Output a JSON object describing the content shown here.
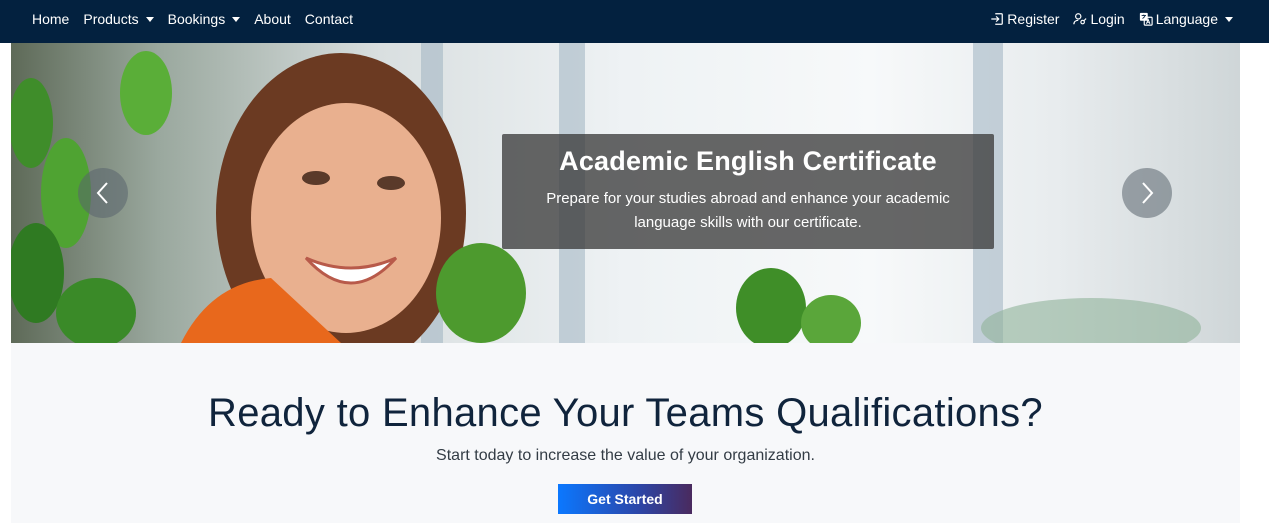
{
  "nav": {
    "left": [
      {
        "label": "Home",
        "dropdown": false
      },
      {
        "label": "Products",
        "dropdown": true
      },
      {
        "label": "Bookings",
        "dropdown": true
      },
      {
        "label": "About",
        "dropdown": false
      },
      {
        "label": "Contact",
        "dropdown": false
      }
    ],
    "register_label": "Register",
    "login_label": "Login",
    "language_label": "Language"
  },
  "hero": {
    "title": "Academic English Certificate",
    "text": "Prepare for your studies abroad and enhance your academic language skills with our certificate."
  },
  "cta": {
    "heading": "Ready to Enhance Your Teams Qualifications?",
    "subtext": "Start today to increase the value of your organization.",
    "button_label": "Get Started"
  },
  "colors": {
    "navbar": "#03213f",
    "cta_background": "#f7f8fa",
    "button_gradient_start": "#0b78ff",
    "button_gradient_end": "#4a2a5e"
  },
  "icons": [
    "sign-in-icon",
    "user-key-icon",
    "translate-icon",
    "chevron-left-icon",
    "chevron-right-icon"
  ]
}
